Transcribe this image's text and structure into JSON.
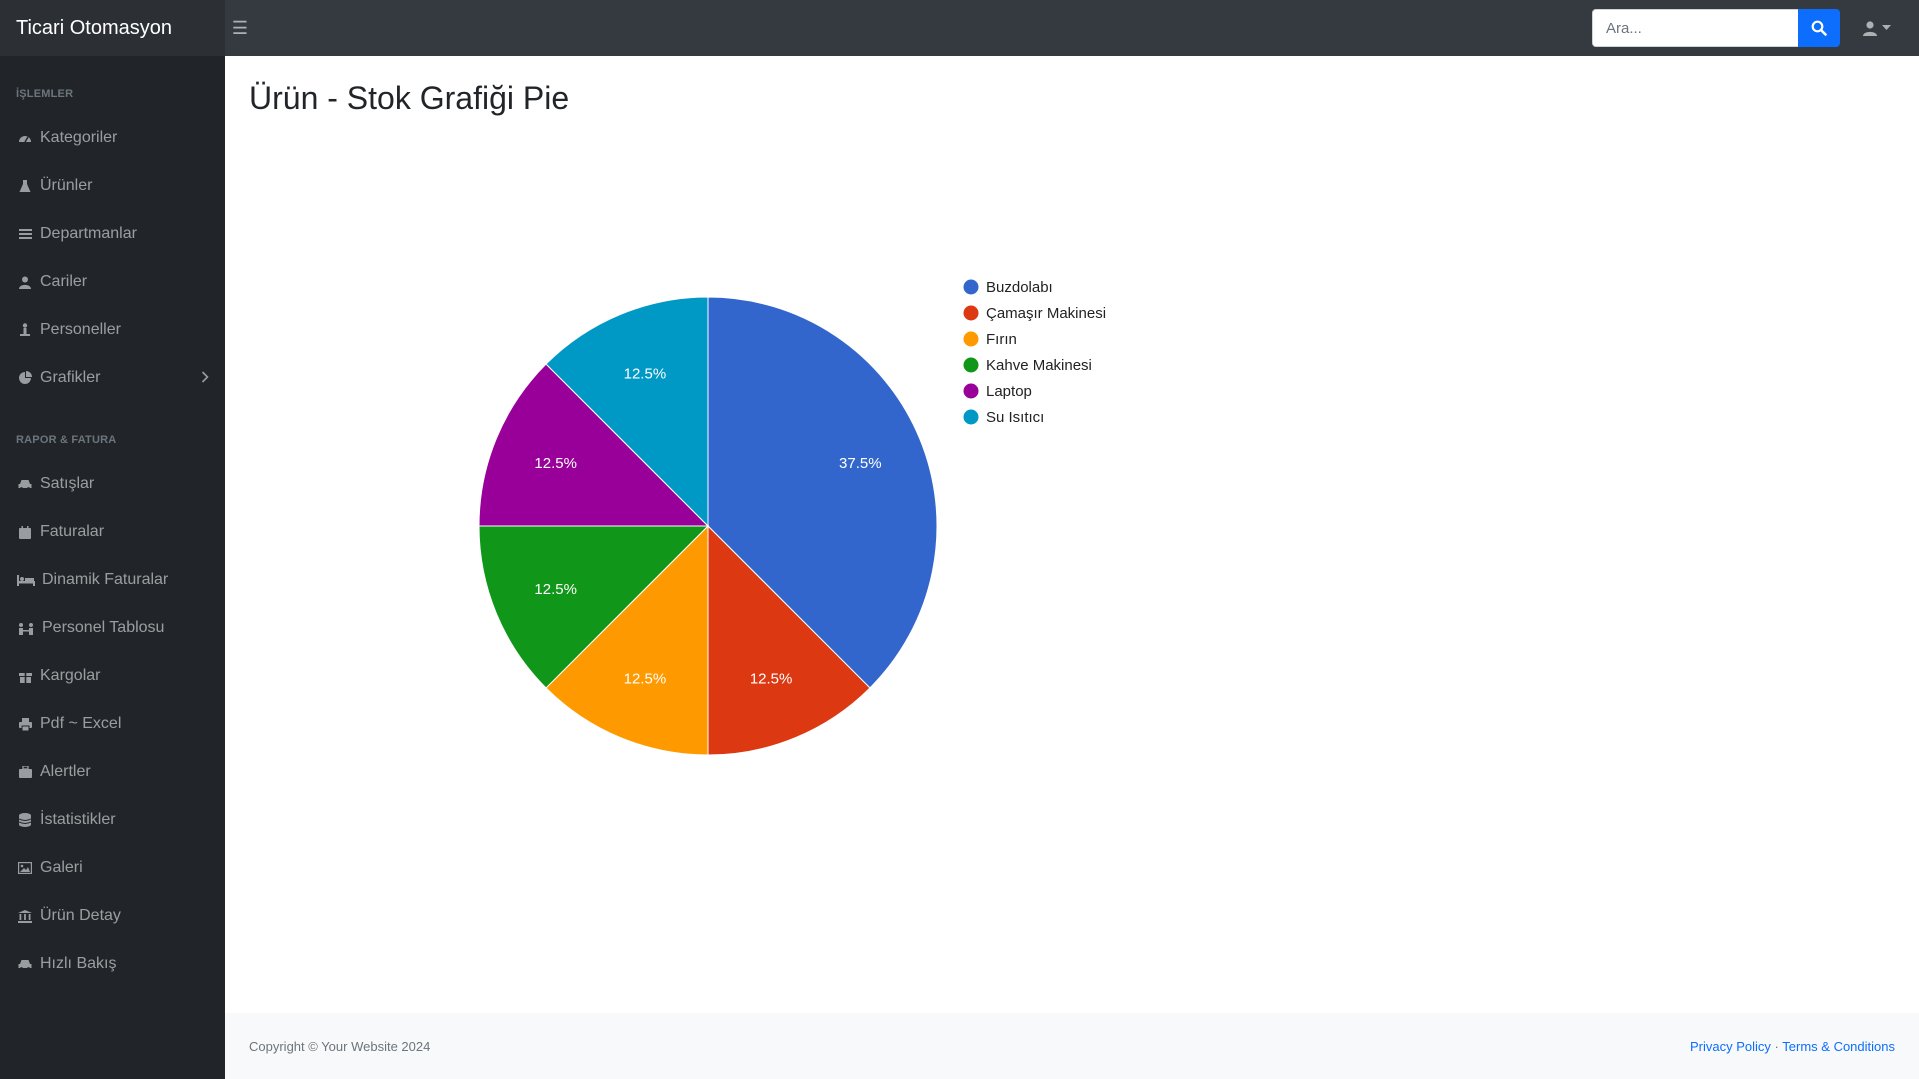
{
  "app": {
    "brand": "Ticari Otomasyon"
  },
  "search": {
    "placeholder": "Ara..."
  },
  "sidebar": {
    "heading_1": "İŞLEMLER",
    "heading_2": "RAPOR & FATURA",
    "items": [
      {
        "label": "Kategoriler",
        "icon": "dashboard-icon"
      },
      {
        "label": "Ürünler",
        "icon": "flask-icon"
      },
      {
        "label": "Departmanlar",
        "icon": "list-icon"
      },
      {
        "label": "Cariler",
        "icon": "user-icon"
      },
      {
        "label": "Personeller",
        "icon": "person-icon"
      },
      {
        "label": "Grafikler",
        "icon": "chart-pie-icon"
      },
      {
        "label": "Satışlar",
        "icon": "car-icon"
      },
      {
        "label": "Faturalar",
        "icon": "calendar-icon"
      },
      {
        "label": "Dinamik Faturalar",
        "icon": "bed-icon"
      },
      {
        "label": "Personel Tablosu",
        "icon": "people-icon"
      },
      {
        "label": "Kargolar",
        "icon": "gift-icon"
      },
      {
        "label": "Pdf ~ Excel",
        "icon": "print-icon"
      },
      {
        "label": "Alertler",
        "icon": "suitcase-icon"
      },
      {
        "label": "İstatistikler",
        "icon": "database-icon"
      },
      {
        "label": "Galeri",
        "icon": "image-icon"
      },
      {
        "label": "Ürün Detay",
        "icon": "bank-icon"
      },
      {
        "label": "Hızlı Bakış",
        "icon": "car-icon"
      }
    ]
  },
  "main": {
    "title": "Ürün - Stok Grafiği Pie"
  },
  "chart_data": {
    "type": "pie",
    "title": "",
    "legend_position": "right",
    "slices": [
      {
        "label": "Buzdolabı",
        "value": 37.5,
        "display": "37.5%",
        "color": "#3366cc"
      },
      {
        "label": "Çamaşır Makinesi",
        "value": 12.5,
        "display": "12.5%",
        "color": "#dc3912"
      },
      {
        "label": "Fırın",
        "value": 12.5,
        "display": "12.5%",
        "color": "#ff9900"
      },
      {
        "label": "Kahve Makinesi",
        "value": 12.5,
        "display": "12.5%",
        "color": "#109618"
      },
      {
        "label": "Laptop",
        "value": 12.5,
        "display": "12.5%",
        "color": "#990099"
      },
      {
        "label": "Su Isıtıcı",
        "value": 12.5,
        "display": "12.5%",
        "color": "#0099c6"
      }
    ]
  },
  "footer": {
    "copyright": "Copyright © Your Website 2024",
    "privacy": "Privacy Policy",
    "separator": "·",
    "terms": "Terms & Conditions"
  },
  "colors": {
    "navbar": "#343a40",
    "sidebar": "#212529",
    "primary": "#0d6efd"
  }
}
